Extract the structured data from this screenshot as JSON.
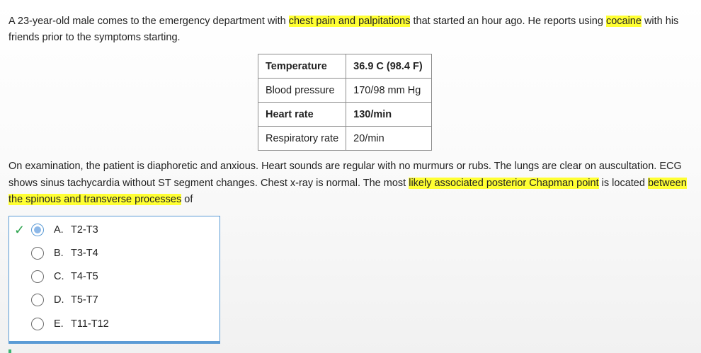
{
  "question": {
    "stem_parts": [
      {
        "text": "A 23-year-old male comes to the emergency department with ",
        "highlight": false
      },
      {
        "text": "chest pain and palpitations",
        "highlight": true
      },
      {
        "text": " that started an hour ago.  He reports using ",
        "highlight": false
      },
      {
        "text": "cocaine",
        "highlight": true
      },
      {
        "text": " with his friends prior to the symptoms starting.",
        "highlight": false
      }
    ],
    "exam_parts": [
      {
        "text": "On examination, the patient is diaphoretic and anxious.  Heart sounds are regular with no murmurs or rubs.  The lungs are clear on auscultation.  ECG shows sinus tachycardia without ST segment changes.  Chest x-ray is normal.  The most ",
        "highlight": false
      },
      {
        "text": "likely associated posterior Chapman point",
        "highlight": true
      },
      {
        "text": " is located ",
        "highlight": false
      },
      {
        "text": "between the spinous and transverse processes",
        "highlight": true
      },
      {
        "text": " of",
        "highlight": false
      }
    ]
  },
  "vitals": [
    {
      "label": "Temperature",
      "value": "36.9 C (98.4 F)",
      "bold": true
    },
    {
      "label": "Blood pressure",
      "value": "170/98 mm Hg",
      "bold": false
    },
    {
      "label": "Heart rate",
      "value": "130/min",
      "bold": true
    },
    {
      "label": "Respiratory rate",
      "value": "20/min",
      "bold": false
    }
  ],
  "choices": [
    {
      "letter": "A.",
      "text": "T2-T3",
      "selected": true,
      "correct_mark": true
    },
    {
      "letter": "B.",
      "text": "T3-T4",
      "selected": false,
      "correct_mark": false
    },
    {
      "letter": "C.",
      "text": "T4-T5",
      "selected": false,
      "correct_mark": false
    },
    {
      "letter": "D.",
      "text": "T5-T7",
      "selected": false,
      "correct_mark": false
    },
    {
      "letter": "E.",
      "text": "T11-T12",
      "selected": false,
      "correct_mark": false
    }
  ],
  "icons": {
    "check": "✓"
  },
  "colors": {
    "highlight": "#ffff33",
    "selected_accent": "#5b9bd5",
    "check": "#2da44e"
  }
}
